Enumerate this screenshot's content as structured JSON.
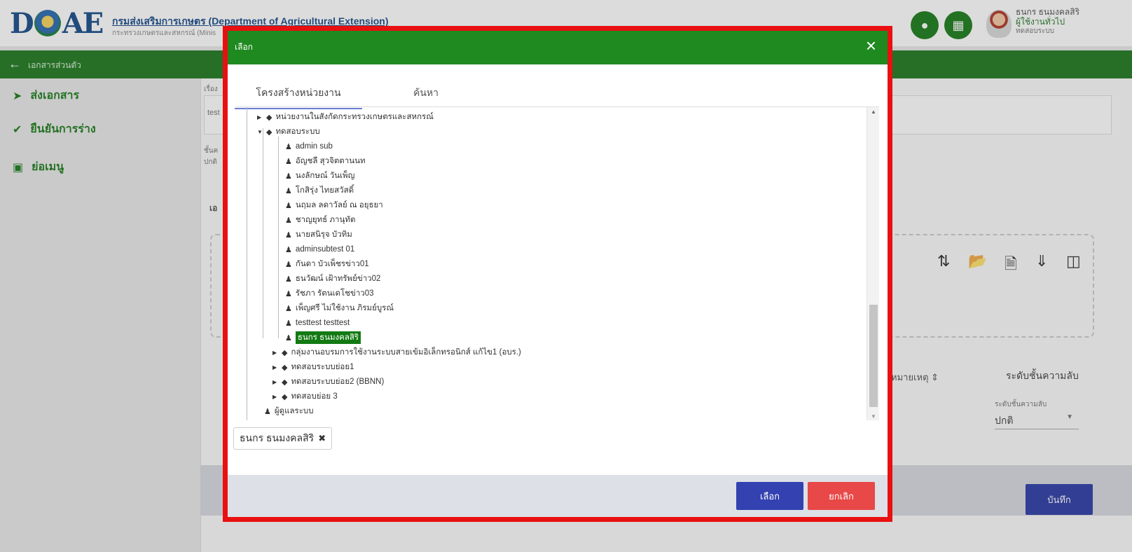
{
  "header": {
    "logo_text": "DOAE",
    "org_name": "กรมส่งเสริมการเกษตร (Department of Agricultural Extension)",
    "org_sub": "กระทรวงเกษตรและสหกรณ์ (Minis",
    "bell_icon": "bell-icon",
    "apps_icon": "grid-icon",
    "user_name": "ธนกร ธนมงคลสิริ",
    "user_role": "ผู้ใช้งานทั่วไป",
    "user_unit": "ทดสอบระบบ"
  },
  "nav": {
    "breadcrumb": "เอกสารส่วนตัว"
  },
  "sidebar": {
    "items": [
      {
        "label": "ส่งเอกสาร",
        "icon": "send-icon"
      },
      {
        "label": "ยืนยันการร่าง",
        "icon": "check-icon"
      },
      {
        "label": "ย่อเมนู",
        "icon": "collapse-icon"
      }
    ]
  },
  "background": {
    "field_label_1": "เรื่อง",
    "field_value_1": "test",
    "field_label_2": "ชั้นค",
    "field_value_2": "ปกติ",
    "section_label": "เอ",
    "col_note": "หมายเหตุ ⇕",
    "col_level": "ระดับชั้นความลับ",
    "level_label": "ระดับชั้นความลับ",
    "level_value": "ปกติ",
    "save_label": "บันทึก"
  },
  "modal": {
    "title": "เลือก",
    "close": "×",
    "tabs": [
      "โครงสร้างหน่วยงาน",
      "ค้นหา"
    ],
    "tree": [
      {
        "label": "หน่วยงานในสังกัดกระทรวงเกษตรและสหกรณ์",
        "kind": "group",
        "expanded": false
      },
      {
        "label": "ทดสอบระบบ",
        "kind": "group",
        "expanded": true
      },
      {
        "label": "admin sub",
        "kind": "user"
      },
      {
        "label": "อัญชลี สุวจิตตานนท",
        "kind": "user"
      },
      {
        "label": "นงลักษณ์ วันเพ็ญ",
        "kind": "user"
      },
      {
        "label": "โกสิรุ่ง ไทยสวัสดิ์",
        "kind": "user"
      },
      {
        "label": "นฤมล ลดาวัลย์ ณ อยุธยา",
        "kind": "user"
      },
      {
        "label": "ชาญยุทธ์ ภานุทัต",
        "kind": "user"
      },
      {
        "label": "นายสนิรุจ บัวทิม",
        "kind": "user"
      },
      {
        "label": "adminsubtest 01",
        "kind": "user"
      },
      {
        "label": "กันดา บัวเพ็ชรข่าว01",
        "kind": "user"
      },
      {
        "label": "ธนวัฒน์ เฝ้าทรัพย์ข่าว02",
        "kind": "user"
      },
      {
        "label": "รัชภา รัตนเดโชข่าว03",
        "kind": "user"
      },
      {
        "label": "เพ็ญศรี ไม่ใช้งาน ภิรมย์บูรณ์",
        "kind": "user"
      },
      {
        "label": "testtest testtest",
        "kind": "user"
      },
      {
        "label": "ธนกร ธนมงคลสิริ",
        "kind": "user",
        "selected": true
      },
      {
        "label": "กลุ่มงานอบรมการใช้งานระบบสายเข้มอิเล็กทรอนิกส์ แก้ไข1 (อบร.)",
        "kind": "group",
        "expanded": false
      },
      {
        "label": "ทดสอบระบบย่อย1",
        "kind": "group",
        "expanded": false
      },
      {
        "label": "ทดสอบระบบย่อย2 (BBNN)",
        "kind": "group",
        "expanded": false
      },
      {
        "label": "ทดสอบย่อย 3",
        "kind": "group",
        "expanded": false
      },
      {
        "label": "ผู้ดูแลระบบ",
        "kind": "user"
      }
    ],
    "chip_label": "ธนกร ธนมงคลสิริ",
    "chip_remove": "✖",
    "select_label": "เลือก",
    "cancel_label": "ยกเลิก"
  },
  "colors": {
    "brand_green": "#1f8a1f",
    "modal_border": "#e81010",
    "primary_button": "#3342b0",
    "danger_button": "#e84848"
  }
}
